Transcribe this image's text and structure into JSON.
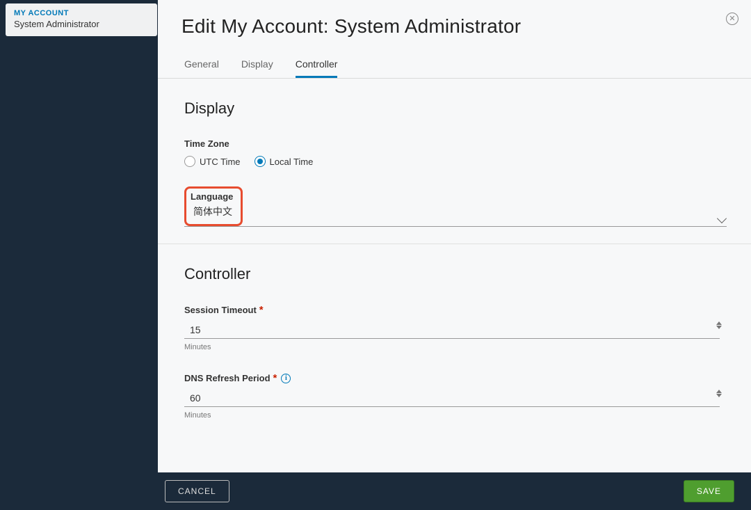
{
  "nav": {
    "title": "MY ACCOUNT",
    "subtitle": "System Administrator"
  },
  "page": {
    "title": "Edit My Account: System Administrator"
  },
  "tabs": {
    "general": "General",
    "display": "Display",
    "controller": "Controller",
    "active": "controller"
  },
  "display_section": {
    "heading": "Display",
    "timezone_label": "Time Zone",
    "utc_label": "UTC Time",
    "local_label": "Local Time",
    "timezone_selected": "Local Time",
    "language_label": "Language",
    "language_value": "简体中文"
  },
  "controller_section": {
    "heading": "Controller",
    "session_label": "Session Timeout",
    "session_value": "15",
    "session_hint": "Minutes",
    "dns_label": "DNS Refresh Period",
    "dns_value": "60",
    "dns_hint": "Minutes"
  },
  "footer": {
    "cancel": "CANCEL",
    "save": "SAVE"
  }
}
